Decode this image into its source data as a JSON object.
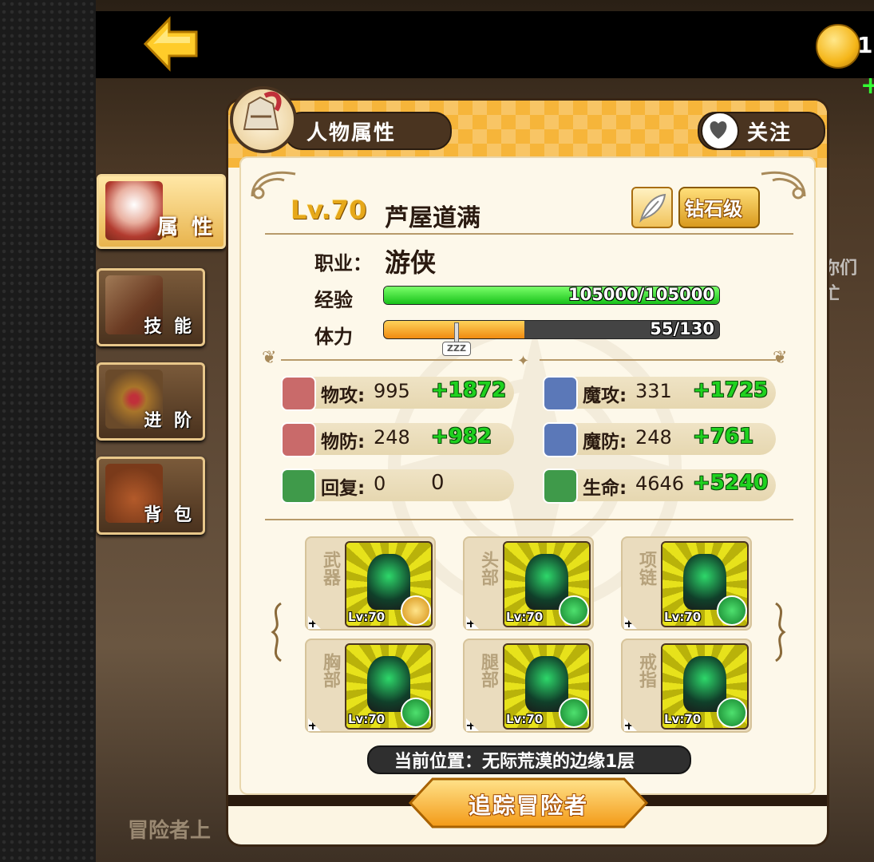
{
  "header": {
    "coin_text": "1",
    "plus": "+"
  },
  "scene": {
    "right_text": "你们忙",
    "bottom_text": "冒险者上"
  },
  "tabs": [
    {
      "label": "属 性",
      "icon": "knight-helmet-icon",
      "active": true
    },
    {
      "label": "技 能",
      "icon": "book-icon",
      "active": false
    },
    {
      "label": "进 阶",
      "icon": "cross-emblem-icon",
      "active": false
    },
    {
      "label": "背 包",
      "icon": "backpack-icon",
      "active": false
    }
  ],
  "panel": {
    "title": "人物属性",
    "follow_label": "关注",
    "level": "Lv.70",
    "name": "芦屋道满",
    "rank": "钻石级",
    "job_label": "职业：",
    "job": "游侠",
    "exp_label": "经验",
    "exp_text": "105000/105000",
    "exp_ratio": 1.0,
    "stamina_label": "体力",
    "stamina_text": "55/130",
    "stamina_ratio": 0.42,
    "zzz": "ZZZ"
  },
  "stats": [
    {
      "label": "物攻:",
      "value": "995",
      "bonus": "+1872",
      "icon": "sword-icon",
      "color": "#c96a6a"
    },
    {
      "label": "魔攻:",
      "value": "331",
      "bonus": "+1725",
      "icon": "hexagram-icon",
      "color": "#5b78b8"
    },
    {
      "label": "物防:",
      "value": "248",
      "bonus": "+982",
      "icon": "shield-icon",
      "color": "#c96a6a"
    },
    {
      "label": "魔防:",
      "value": "248",
      "bonus": "+761",
      "icon": "magic-shield-icon",
      "color": "#5b78b8"
    },
    {
      "label": "回复:",
      "value": "0",
      "bonus": "0",
      "icon": "plus-cross-icon",
      "color": "#3f9a4a"
    },
    {
      "label": "生命:",
      "value": "4646",
      "bonus": "+5240",
      "icon": "heart-icon",
      "color": "#3f9a4a"
    }
  ],
  "equipment": [
    {
      "slot": "武器",
      "level": "Lv:70",
      "icon": "bow-icon",
      "badge": "gold"
    },
    {
      "slot": "头部",
      "level": "Lv:70",
      "icon": "helmet-icon",
      "badge": "green"
    },
    {
      "slot": "项链",
      "level": "Lv:70",
      "icon": "necklace-icon",
      "badge": "green"
    },
    {
      "slot": "胸部",
      "level": "Lv:70",
      "icon": "armor-icon",
      "badge": "green"
    },
    {
      "slot": "腿部",
      "level": "Lv:70",
      "icon": "boots-icon",
      "badge": "green"
    },
    {
      "slot": "戒指",
      "level": "Lv:70",
      "icon": "ring-icon",
      "badge": "green"
    }
  ],
  "location": "当前位置：无际荒漠的边缘1层",
  "track_button": "追踪冒险者"
}
